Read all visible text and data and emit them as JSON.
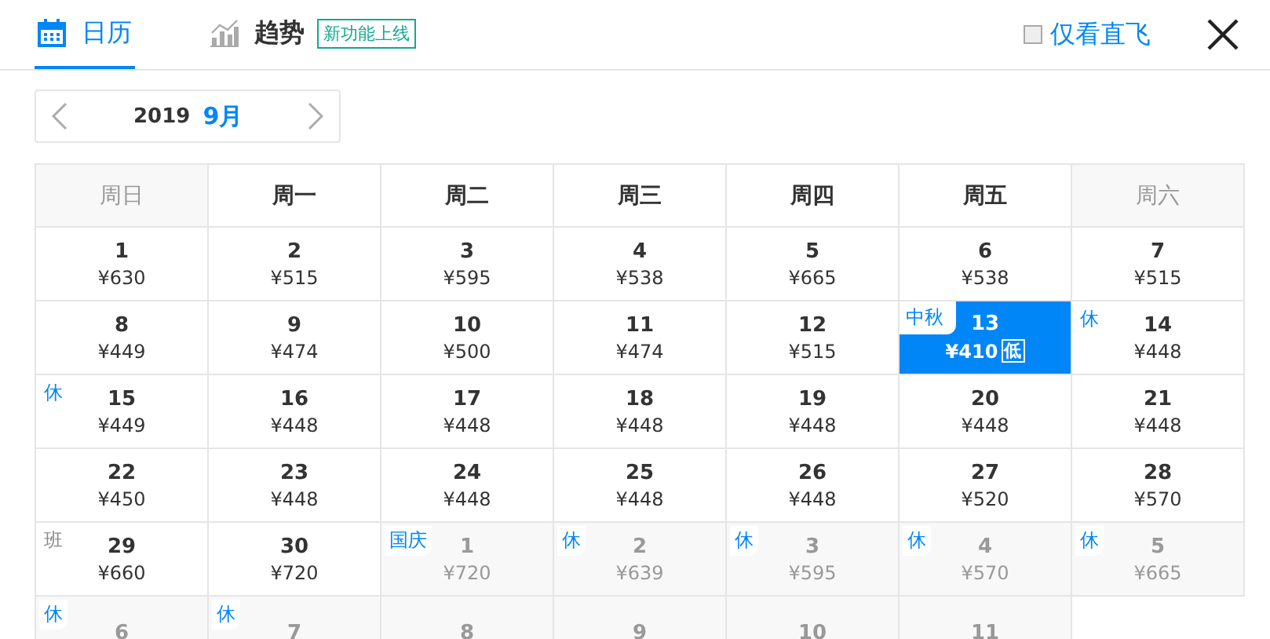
{
  "tabs": [
    {
      "label": "日历",
      "kind": "calendar",
      "selected": true
    },
    {
      "label": "趋势",
      "kind": "trend",
      "selected": false,
      "badge": "新功能上线"
    }
  ],
  "direct_only": {
    "label": "仅看直飞",
    "checked": false
  },
  "month_picker": {
    "year": "2019",
    "month": "9月"
  },
  "weekdays": [
    {
      "label": "周日",
      "weekend": true
    },
    {
      "label": "周一",
      "weekend": false
    },
    {
      "label": "周二",
      "weekend": false
    },
    {
      "label": "周三",
      "weekend": false
    },
    {
      "label": "周四",
      "weekend": false
    },
    {
      "label": "周五",
      "weekend": false
    },
    {
      "label": "周六",
      "weekend": true
    }
  ],
  "weeks": [
    [
      {
        "day": "1",
        "price": "¥630",
        "in_month": true,
        "selected": false
      },
      {
        "day": "2",
        "price": "¥515",
        "in_month": true,
        "selected": false
      },
      {
        "day": "3",
        "price": "¥595",
        "in_month": true,
        "selected": false
      },
      {
        "day": "4",
        "price": "¥538",
        "in_month": true,
        "selected": false
      },
      {
        "day": "5",
        "price": "¥665",
        "in_month": true,
        "selected": false
      },
      {
        "day": "6",
        "price": "¥538",
        "in_month": true,
        "selected": false
      },
      {
        "day": "7",
        "price": "¥515",
        "in_month": true,
        "selected": false
      }
    ],
    [
      {
        "day": "8",
        "price": "¥449",
        "in_month": true,
        "selected": false
      },
      {
        "day": "9",
        "price": "¥474",
        "in_month": true,
        "selected": false
      },
      {
        "day": "10",
        "price": "¥500",
        "in_month": true,
        "selected": false
      },
      {
        "day": "11",
        "price": "¥474",
        "in_month": true,
        "selected": false
      },
      {
        "day": "12",
        "price": "¥515",
        "in_month": true,
        "selected": false
      },
      {
        "day": "13",
        "price": "¥410",
        "in_month": true,
        "selected": true,
        "tag": {
          "text": "中秋",
          "kind": "holiday"
        },
        "badge": "低"
      },
      {
        "day": "14",
        "price": "¥448",
        "in_month": true,
        "selected": false,
        "tag": {
          "text": "休",
          "kind": "holiday"
        }
      }
    ],
    [
      {
        "day": "15",
        "price": "¥449",
        "in_month": true,
        "selected": false,
        "tag": {
          "text": "休",
          "kind": "holiday"
        }
      },
      {
        "day": "16",
        "price": "¥448",
        "in_month": true,
        "selected": false
      },
      {
        "day": "17",
        "price": "¥448",
        "in_month": true,
        "selected": false
      },
      {
        "day": "18",
        "price": "¥448",
        "in_month": true,
        "selected": false
      },
      {
        "day": "19",
        "price": "¥448",
        "in_month": true,
        "selected": false
      },
      {
        "day": "20",
        "price": "¥448",
        "in_month": true,
        "selected": false
      },
      {
        "day": "21",
        "price": "¥448",
        "in_month": true,
        "selected": false
      }
    ],
    [
      {
        "day": "22",
        "price": "¥450",
        "in_month": true,
        "selected": false
      },
      {
        "day": "23",
        "price": "¥448",
        "in_month": true,
        "selected": false
      },
      {
        "day": "24",
        "price": "¥448",
        "in_month": true,
        "selected": false
      },
      {
        "day": "25",
        "price": "¥448",
        "in_month": true,
        "selected": false
      },
      {
        "day": "26",
        "price": "¥448",
        "in_month": true,
        "selected": false
      },
      {
        "day": "27",
        "price": "¥520",
        "in_month": true,
        "selected": false
      },
      {
        "day": "28",
        "price": "¥570",
        "in_month": true,
        "selected": false
      }
    ],
    [
      {
        "day": "29",
        "price": "¥660",
        "in_month": true,
        "selected": false,
        "tag": {
          "text": "班",
          "kind": "workday"
        }
      },
      {
        "day": "30",
        "price": "¥720",
        "in_month": true,
        "selected": false
      },
      {
        "day": "1",
        "price": "¥720",
        "in_month": false,
        "selected": false,
        "tag": {
          "text": "国庆",
          "kind": "holiday"
        }
      },
      {
        "day": "2",
        "price": "¥639",
        "in_month": false,
        "selected": false,
        "tag": {
          "text": "休",
          "kind": "holiday"
        }
      },
      {
        "day": "3",
        "price": "¥595",
        "in_month": false,
        "selected": false,
        "tag": {
          "text": "休",
          "kind": "holiday"
        }
      },
      {
        "day": "4",
        "price": "¥570",
        "in_month": false,
        "selected": false,
        "tag": {
          "text": "休",
          "kind": "holiday"
        }
      },
      {
        "day": "5",
        "price": "¥665",
        "in_month": false,
        "selected": false,
        "tag": {
          "text": "休",
          "kind": "holiday"
        }
      }
    ],
    [
      {
        "day": "6",
        "in_month": false,
        "selected": false,
        "tag": {
          "text": "休",
          "kind": "holiday"
        }
      },
      {
        "day": "7",
        "in_month": false,
        "selected": false,
        "tag": {
          "text": "休",
          "kind": "holiday"
        }
      },
      {
        "day": "8",
        "in_month": false,
        "selected": false
      },
      {
        "day": "9",
        "in_month": false,
        "selected": false
      },
      {
        "day": "10",
        "in_month": false,
        "selected": false
      },
      {
        "day": "11",
        "in_month": false,
        "selected": false
      }
    ]
  ]
}
